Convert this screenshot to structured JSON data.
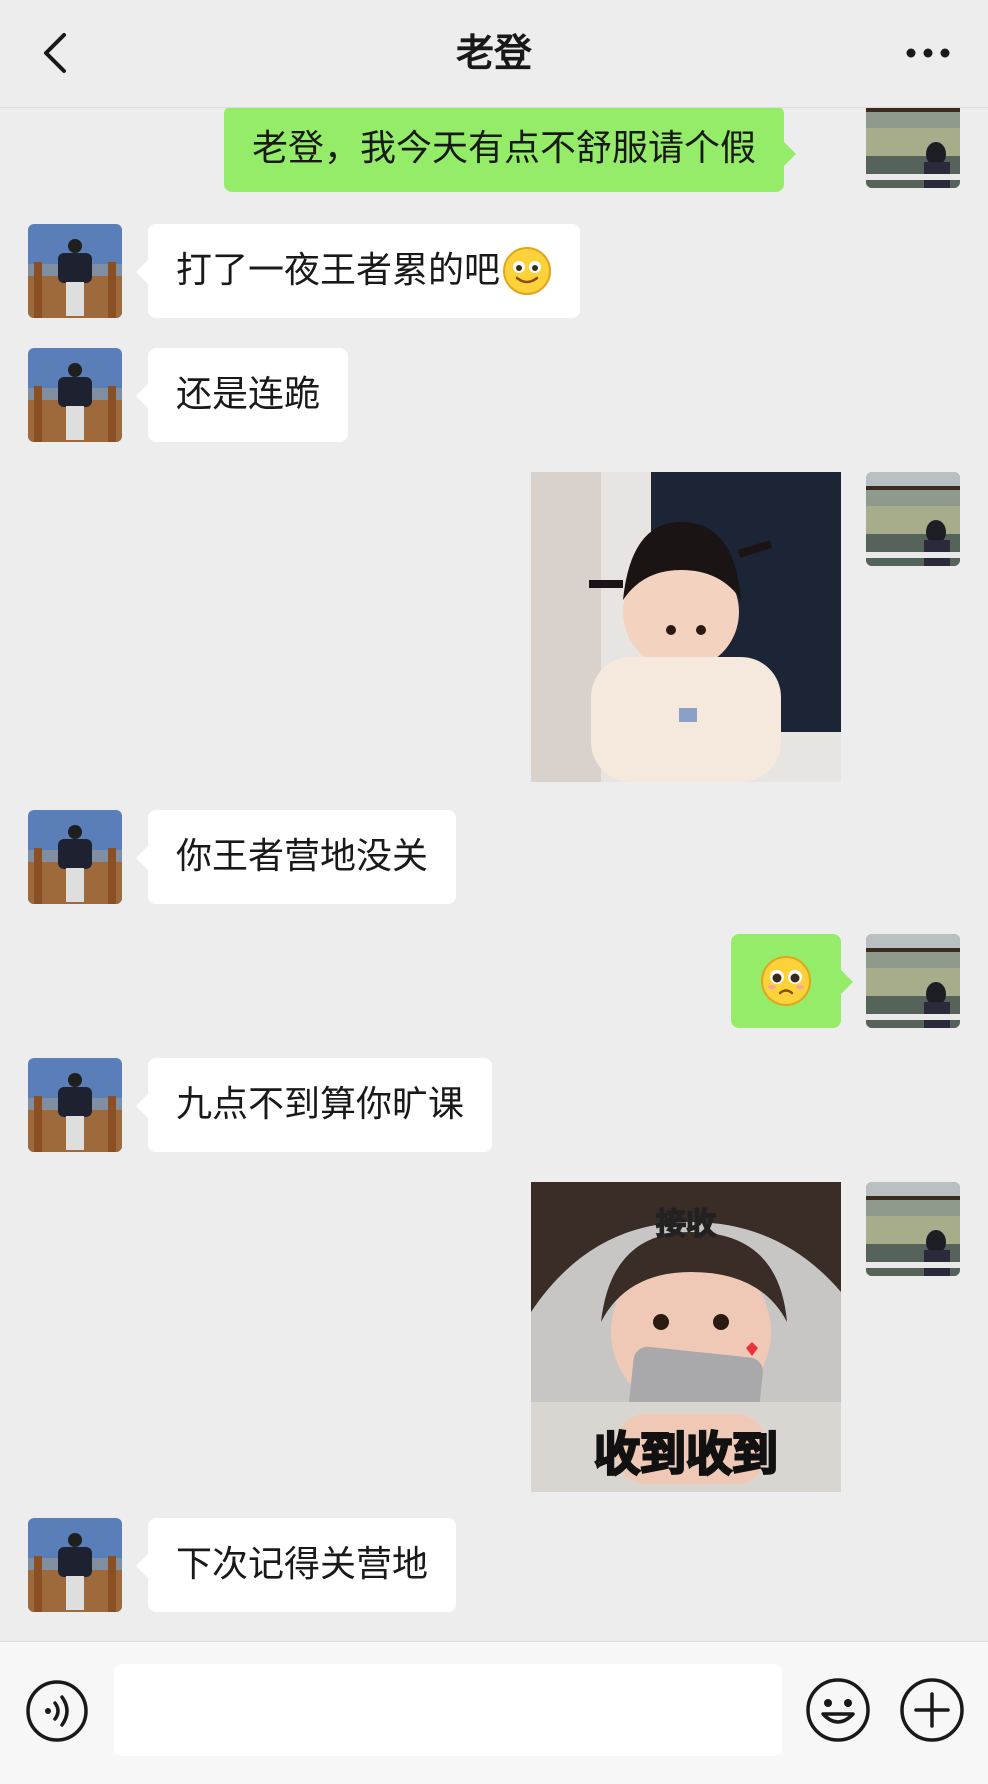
{
  "header": {
    "title": "老登",
    "back_icon": "chevron-left-icon",
    "more_icon": "more-dots-icon"
  },
  "messages": [
    {
      "from": "me",
      "type": "text",
      "text": "老登，我今天有点不舒服请个假"
    },
    {
      "from": "them",
      "type": "text",
      "text": "打了一夜王者累的吧",
      "emoji": "smile-emoji-icon"
    },
    {
      "from": "them",
      "type": "text",
      "text": "还是连跪"
    },
    {
      "from": "me",
      "type": "sticker",
      "sticker": "girl-pigtails-sticker"
    },
    {
      "from": "them",
      "type": "text",
      "text": "你王者营地没关"
    },
    {
      "from": "me",
      "type": "emoji",
      "emoji": "pleading-face-emoji-icon"
    },
    {
      "from": "them",
      "type": "text",
      "text": "九点不到算你旷课"
    },
    {
      "from": "me",
      "type": "sticker",
      "sticker": "girl-phone-sticker",
      "caption_top": "接收",
      "caption_bottom": "收到收到"
    },
    {
      "from": "them",
      "type": "text",
      "text": "下次记得关营地"
    }
  ],
  "footer": {
    "input_value": "",
    "voice_icon": "voice-icon",
    "emoji_icon": "emoji-icon",
    "plus_icon": "plus-icon"
  },
  "colors": {
    "background": "#ededed",
    "outgoing_bubble": "#95ec69",
    "incoming_bubble": "#ffffff"
  }
}
